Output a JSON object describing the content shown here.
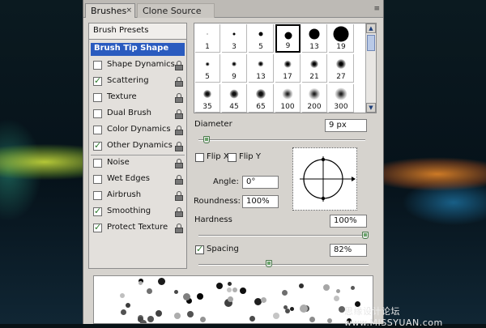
{
  "tabs": [
    {
      "label": "Brushes"
    },
    {
      "label": "Clone Source"
    }
  ],
  "tab_close_glyph": "×",
  "panel_menu_glyph": "≡",
  "sidebar": {
    "header": "Brush Presets",
    "selected": "Brush Tip Shape",
    "items": [
      {
        "label": "Shape Dynamics",
        "checked": false
      },
      {
        "label": "Scattering",
        "checked": true
      },
      {
        "label": "Texture",
        "checked": false
      },
      {
        "label": "Dual Brush",
        "checked": false
      },
      {
        "label": "Color Dynamics",
        "checked": false
      },
      {
        "label": "Other Dynamics",
        "checked": true
      },
      {
        "label": "Noise",
        "checked": false
      },
      {
        "label": "Wet Edges",
        "checked": false
      },
      {
        "label": "Airbrush",
        "checked": false
      },
      {
        "label": "Smoothing",
        "checked": true
      },
      {
        "label": "Protect Texture",
        "checked": true
      }
    ]
  },
  "presets": {
    "rows": [
      [
        "1",
        "3",
        "5",
        "9",
        "13",
        "19"
      ],
      [
        "5",
        "9",
        "13",
        "17",
        "21",
        "27"
      ],
      [
        "35",
        "45",
        "65",
        "100",
        "200",
        "300"
      ]
    ],
    "selected": "9"
  },
  "diameter": {
    "label": "Diameter",
    "value": "9 px",
    "slider_fraction": 0.03
  },
  "flip_x": {
    "label": "Flip X",
    "checked": false
  },
  "flip_y": {
    "label": "Flip Y",
    "checked": false
  },
  "angle": {
    "label": "Angle:",
    "value": "0°"
  },
  "roundness": {
    "label": "Roundness:",
    "value": "100%"
  },
  "hardness": {
    "label": "Hardness",
    "value": "100%",
    "slider_fraction": 1.0
  },
  "spacing": {
    "label": "Spacing",
    "value": "82%",
    "checked": true,
    "slider_fraction": 0.41
  },
  "watermark": "思缘设计论坛 www.MISSYUAN.com",
  "colors": {
    "selected_row": "#2a5bbf",
    "panel": "#d6d3ce",
    "check": "#2a7a2a"
  }
}
